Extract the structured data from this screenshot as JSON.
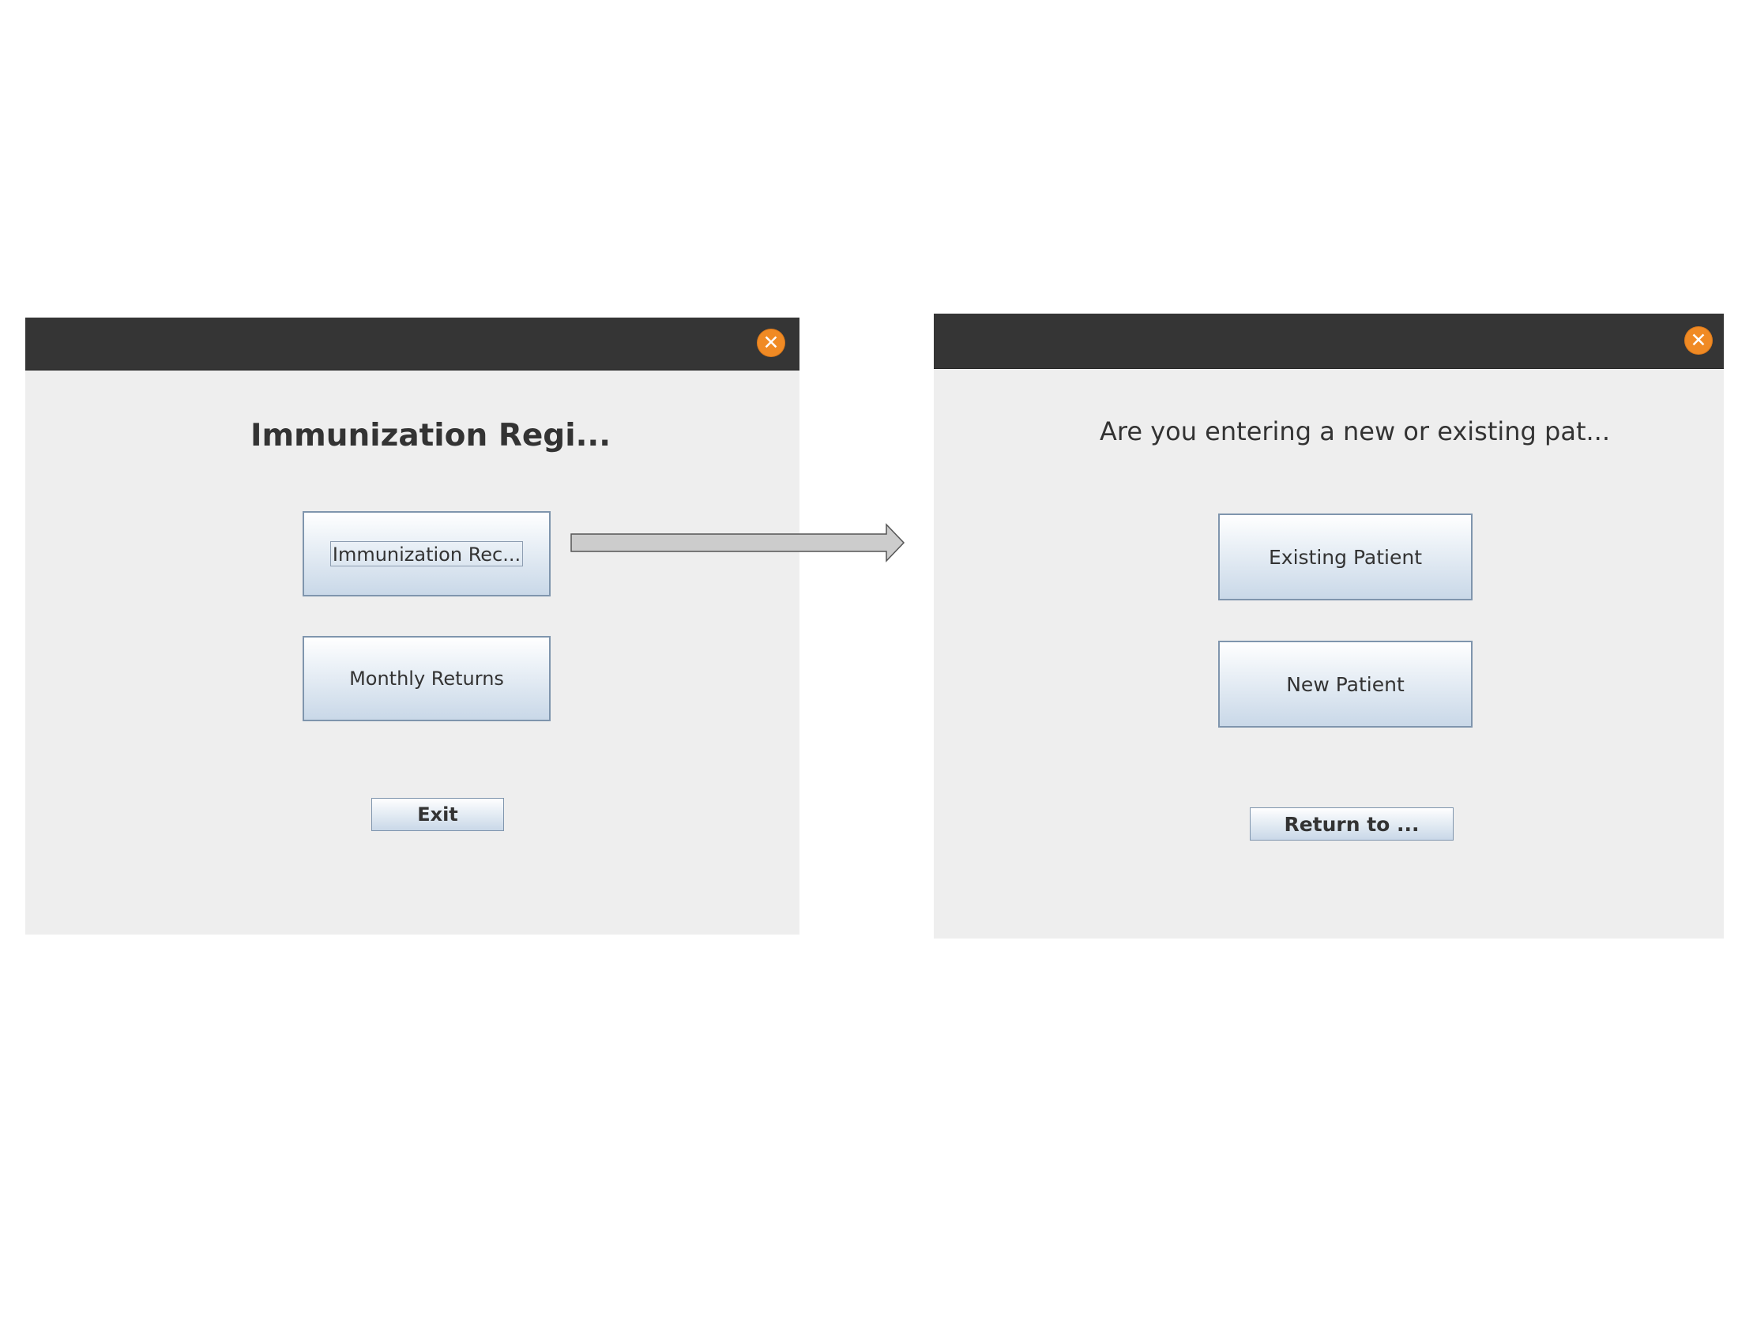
{
  "left_window": {
    "close_icon": "close-icon",
    "heading": "Immunization Regi...",
    "buttons": {
      "immunization_records": "Immunization Rec...",
      "monthly_returns": "Monthly Returns",
      "exit": "Exit"
    }
  },
  "right_window": {
    "close_icon": "close-icon",
    "question": "Are you entering a new or existing pat...",
    "buttons": {
      "existing_patient": "Existing Patient",
      "new_patient": "New Patient",
      "return_to": "Return to ..."
    }
  },
  "colors": {
    "titlebar": "#353535",
    "window_bg": "#eeeeee",
    "close_button": "#f08a24",
    "button_border": "#7f95ad",
    "arrow_fill": "#cccccc"
  }
}
